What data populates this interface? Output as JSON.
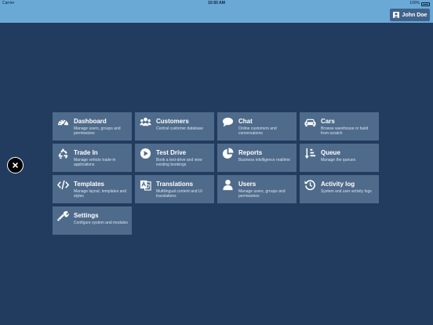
{
  "status_bar": {
    "carrier": "Carrier",
    "time": "10:50 AM",
    "battery": "100%"
  },
  "header": {
    "user_name": "John Doe"
  },
  "tiles": [
    {
      "title": "Dashboard",
      "desc": "Manage users, groups and permissions",
      "icon": "dashboard-icon"
    },
    {
      "title": "Customers",
      "desc": "Central customer database",
      "icon": "users-icon"
    },
    {
      "title": "Chat",
      "desc": "Online customers and conversations",
      "icon": "chat-icon"
    },
    {
      "title": "Cars",
      "desc": "Browse warehouse or build from scratch",
      "icon": "car-icon"
    },
    {
      "title": "Trade In",
      "desc": "Manage vehicle trade-in applications",
      "icon": "recycle-icon"
    },
    {
      "title": "Test Drive",
      "desc": "Book a test-drive and view existing bookings",
      "icon": "play-icon"
    },
    {
      "title": "Reports",
      "desc": "Business intelligence realtime",
      "icon": "pie-chart-icon"
    },
    {
      "title": "Queue",
      "desc": "Manage the queues",
      "icon": "sort-icon"
    },
    {
      "title": "Templates",
      "desc": "Manage layout, templates and styles",
      "icon": "code-icon"
    },
    {
      "title": "Translations",
      "desc": "Multilingual content and UI translations",
      "icon": "translate-icon"
    },
    {
      "title": "Users",
      "desc": "Manage users, groups and permissions",
      "icon": "user-icon"
    },
    {
      "title": "Activity log",
      "desc": "System and user activity logs",
      "icon": "history-icon"
    },
    {
      "title": "Settings",
      "desc": "Configure system and modules",
      "icon": "wrench-icon"
    }
  ]
}
